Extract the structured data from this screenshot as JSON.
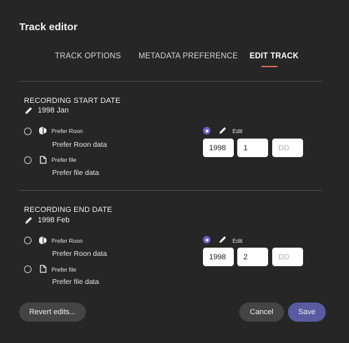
{
  "dialog": {
    "title": "Track editor"
  },
  "tabs": [
    {
      "label": "TRACK OPTIONS",
      "active": false
    },
    {
      "label": "METADATA PREFERENCE",
      "active": false
    },
    {
      "label": "EDIT TRACK",
      "active": true
    }
  ],
  "sections": [
    {
      "title": "RECORDING START DATE",
      "current_value": "1998 Jan",
      "options": {
        "roon": {
          "label": "Prefer Roon",
          "description": "Prefer Roon data",
          "selected": false
        },
        "file": {
          "label": "Prefer file",
          "description": "Prefer file data",
          "selected": false
        },
        "edit": {
          "label": "Edit",
          "selected": true
        }
      },
      "inputs": {
        "year": "1998",
        "month": "1",
        "day_placeholder": "DD"
      }
    },
    {
      "title": "RECORDING END DATE",
      "current_value": "1998 Feb",
      "options": {
        "roon": {
          "label": "Prefer Roon",
          "description": "Prefer Roon data",
          "selected": false
        },
        "file": {
          "label": "Prefer file",
          "description": "Prefer file data",
          "selected": false
        },
        "edit": {
          "label": "Edit",
          "selected": true
        }
      },
      "inputs": {
        "year": "1998",
        "month": "2",
        "day_placeholder": "DD"
      }
    }
  ],
  "footer": {
    "revert_label": "Revert edits...",
    "cancel_label": "Cancel",
    "save_label": "Save"
  },
  "colors": {
    "background": "#262626",
    "accent": "#6a5fd0",
    "tab_underline": "#d9645a",
    "save_button": "#5a5aa3",
    "secondary_button": "#444444"
  },
  "icons": {
    "current_value": "pencil-icon",
    "roon_option": "roon-logo-icon",
    "file_option": "file-icon",
    "edit_option": "pencil-icon"
  }
}
